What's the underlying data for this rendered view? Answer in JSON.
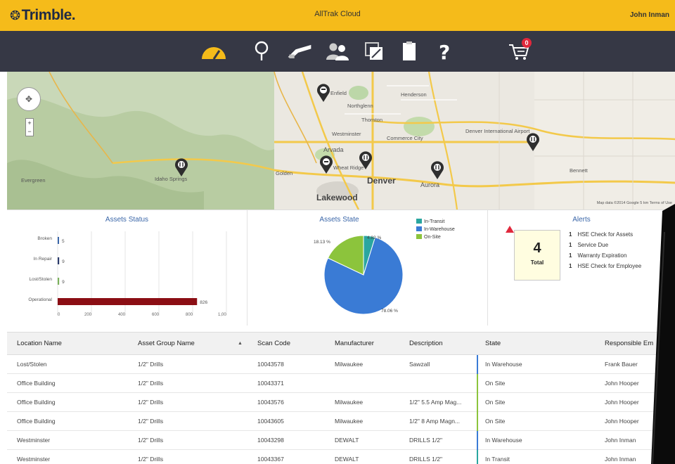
{
  "app": {
    "logo": "Trimble.",
    "title": "AllTrak Cloud",
    "user": "John Inman"
  },
  "nav": {
    "items": [
      {
        "name": "dashboard-icon"
      },
      {
        "name": "location-icon"
      },
      {
        "name": "tools-icon"
      },
      {
        "name": "users-icon"
      },
      {
        "name": "documents-icon"
      },
      {
        "name": "clipboard-icon"
      },
      {
        "name": "help-icon"
      },
      {
        "name": "cart-icon"
      }
    ],
    "cart_badge": "0"
  },
  "map": {
    "labels": [
      {
        "text": "Enfield"
      },
      {
        "text": "Northglenn"
      },
      {
        "text": "Henderson"
      },
      {
        "text": "Thornton"
      },
      {
        "text": "Westminster"
      },
      {
        "text": "Commerce City"
      },
      {
        "text": "Arvada"
      },
      {
        "text": "Wheat Ridge"
      },
      {
        "text": "Denver"
      },
      {
        "text": "Aurora"
      },
      {
        "text": "Lakewood"
      },
      {
        "text": "Golden"
      },
      {
        "text": "Evergreen"
      },
      {
        "text": "Idaho Springs"
      },
      {
        "text": "Denver International Airport"
      },
      {
        "text": "Bennett"
      }
    ],
    "credit": "Map data ©2014 Google  5 km  Terms of Use"
  },
  "assets_status": {
    "title": "Assets Status",
    "bars": [
      {
        "label": "Broken",
        "value": 5,
        "color": "#3a66a8"
      },
      {
        "label": "In Repair",
        "value": 9,
        "color": "#2a3a6a"
      },
      {
        "label": "Lost/Stolen",
        "value": 9,
        "color": "#7ab05a"
      },
      {
        "label": "Operational",
        "value": 826,
        "color": "#8b0e14"
      }
    ],
    "ticks": [
      "0",
      "200",
      "400",
      "600",
      "800",
      "1,00"
    ]
  },
  "assets_state": {
    "title": "Assets State",
    "legend": [
      {
        "label": "In-Transit",
        "color": "#2aa6a0"
      },
      {
        "label": "In-Warehouse",
        "color": "#3a7bd5"
      },
      {
        "label": "On-Site",
        "color": "#8cc43c"
      }
    ],
    "slices": [
      {
        "label": "In-Transit",
        "value": 4.82,
        "color": "#2aa6a0"
      },
      {
        "label": "In-Warehouse",
        "value": 78.06,
        "color": "#3a7bd5"
      },
      {
        "label": "On-Site",
        "value": 18.13,
        "color": "#8cc43c"
      }
    ],
    "labels": {
      "transit": "4.82 %",
      "warehouse": "78.06 %",
      "onsite": "18.13 %"
    }
  },
  "alerts": {
    "title": "Alerts",
    "total_value": "4",
    "total_label": "Total",
    "items": [
      {
        "count": "1",
        "text": "HSE Check for Assets"
      },
      {
        "count": "1",
        "text": "Service Due"
      },
      {
        "count": "1",
        "text": "Warranty Expiration"
      },
      {
        "count": "1",
        "text": "HSE Check for Employee"
      }
    ]
  },
  "table": {
    "headers": [
      "Location Name",
      "Asset Group Name",
      "Scan Code",
      "Manufacturer",
      "Description",
      "State",
      "Responsible Em"
    ],
    "sort_indicator": "▲",
    "rows": [
      {
        "location": "Lost/Stolen",
        "group": "1/2\" Drills",
        "scan": "10043578",
        "manufacturer": "Milwaukee",
        "description": "Sawzall",
        "state": "In Warehouse",
        "responsible": "Frank Bauer",
        "state_color": "#3a7bd5"
      },
      {
        "location": "Office Building",
        "group": "1/2\" Drills",
        "scan": "10043371",
        "manufacturer": "",
        "description": "",
        "state": "On Site",
        "responsible": "John Hooper",
        "state_color": "#8cc43c"
      },
      {
        "location": "Office Building",
        "group": "1/2\" Drills",
        "scan": "10043576",
        "manufacturer": "Milwaukee",
        "description": "1/2\" 5.5 Amp Mag...",
        "state": "On Site",
        "responsible": "John Hooper",
        "state_color": "#8cc43c"
      },
      {
        "location": "Office Building",
        "group": "1/2\" Drills",
        "scan": "10043605",
        "manufacturer": "Milwaukee",
        "description": "1/2\" 8 Amp Magn...",
        "state": "On Site",
        "responsible": "John Hooper",
        "state_color": "#8cc43c"
      },
      {
        "location": "Westminster",
        "group": "1/2\" Drills",
        "scan": "10043298",
        "manufacturer": "DEWALT",
        "description": "DRILLS 1/2\"",
        "state": "In Warehouse",
        "responsible": "John Inman",
        "state_color": "#3a7bd5"
      },
      {
        "location": "Westminster",
        "group": "1/2\" Drills",
        "scan": "10043367",
        "manufacturer": "DEWALT",
        "description": "DRILLS 1/2\"",
        "state": "In Transit",
        "responsible": "John Inman",
        "state_color": "#2aa6a0"
      }
    ]
  }
}
